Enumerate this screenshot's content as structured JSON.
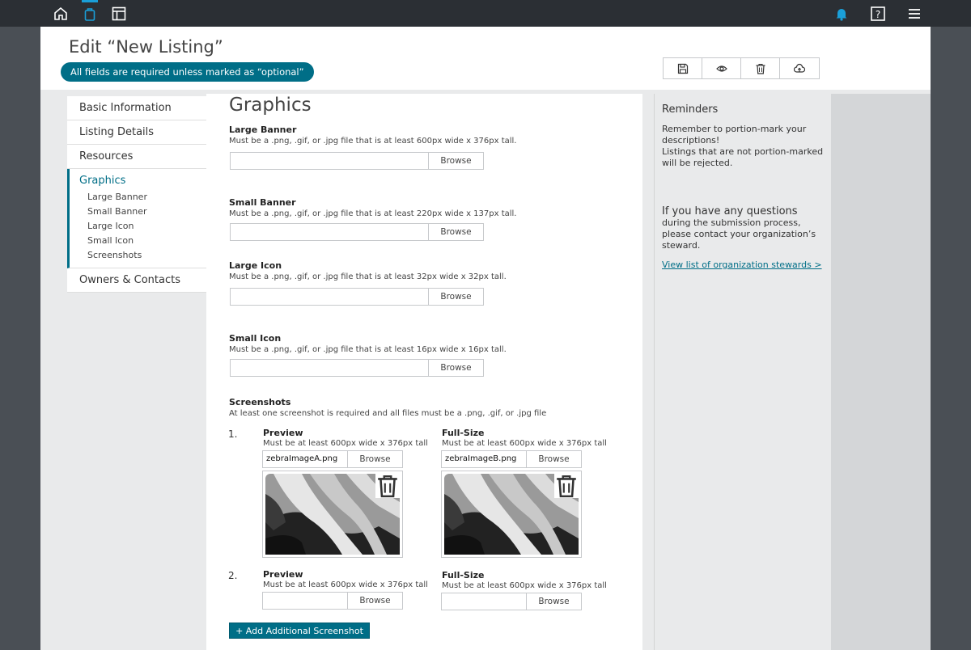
{
  "topbar": {
    "left_icons": [
      "home-icon",
      "bag-icon",
      "layout-icon"
    ],
    "right_icons": [
      "bell-icon",
      "help-icon",
      "menu-icon"
    ],
    "accent": "#1a9fd8"
  },
  "header": {
    "title": "Edit “New Listing”",
    "required_note": "All fields are required unless marked as “optional”",
    "toolbar": [
      "save-icon",
      "preview-icon",
      "delete-icon",
      "upload-icon"
    ]
  },
  "nav": {
    "items_top": [
      "Basic Information",
      "Listing Details",
      "Resources"
    ],
    "active": "Graphics",
    "sub_items": [
      "Large Banner",
      "Small Banner",
      "Large Icon",
      "Small Icon",
      "Screenshots"
    ],
    "items_bottom": [
      "Owners & Contacts"
    ]
  },
  "main": {
    "section_title": "Graphics",
    "fields": [
      {
        "label": "Large Banner",
        "hint": "Must be a .png, .gif, or .jpg file that is at least 600px wide x 376px tall.",
        "browse": "Browse",
        "value": ""
      },
      {
        "label": "Small Banner",
        "hint": "Must be a .png, .gif, or .jpg file that is at least 220px wide x 137px tall.",
        "browse": "Browse",
        "value": ""
      },
      {
        "label": "Large Icon",
        "hint": "Must be a .png, .gif, or .jpg file that is at least 32px wide x 32px tall.",
        "browse": "Browse",
        "value": ""
      },
      {
        "label": "Small Icon",
        "hint": "Must be a .png, .gif, or .jpg file that is at least 16px wide x 16px tall.",
        "browse": "Browse",
        "value": ""
      }
    ],
    "screenshots": {
      "label": "Screenshots",
      "hint": "At least one screenshot is required and all files must be a .png, .gif, or .jpg file",
      "rows": [
        {
          "number": "1.",
          "preview": {
            "label": "Preview",
            "hint": "Must be at least 600px wide x 376px tall",
            "file": "zebraImageA.png",
            "browse": "Browse"
          },
          "full": {
            "label": "Full-Size",
            "hint": "Must be at least 600px wide x 376px tall",
            "file": "zebraImageB.png",
            "browse": "Browse"
          }
        },
        {
          "number": "2.",
          "preview": {
            "label": "Preview",
            "hint": "Must be at least 600px wide x 376px tall",
            "file": "",
            "browse": "Browse"
          },
          "full": {
            "label": "Full-Size",
            "hint": "Must be at least 600px wide x 376px tall",
            "file": "",
            "browse": "Browse"
          }
        }
      ],
      "add_button": "+ Add Additional Screenshot"
    }
  },
  "reminders": {
    "title": "Reminders",
    "text1": "Remember to portion-mark your descriptions!",
    "text2": "Listings that are not portion-marked will be rejected.",
    "question_title": "If you have any questions",
    "question_text": "during the submission process, please contact your organization’s steward.",
    "link": "View list of organization stewards >"
  },
  "colors": {
    "brand": "#006e87",
    "topbar": "#2b2f34",
    "notify": "#1a9fd8"
  }
}
